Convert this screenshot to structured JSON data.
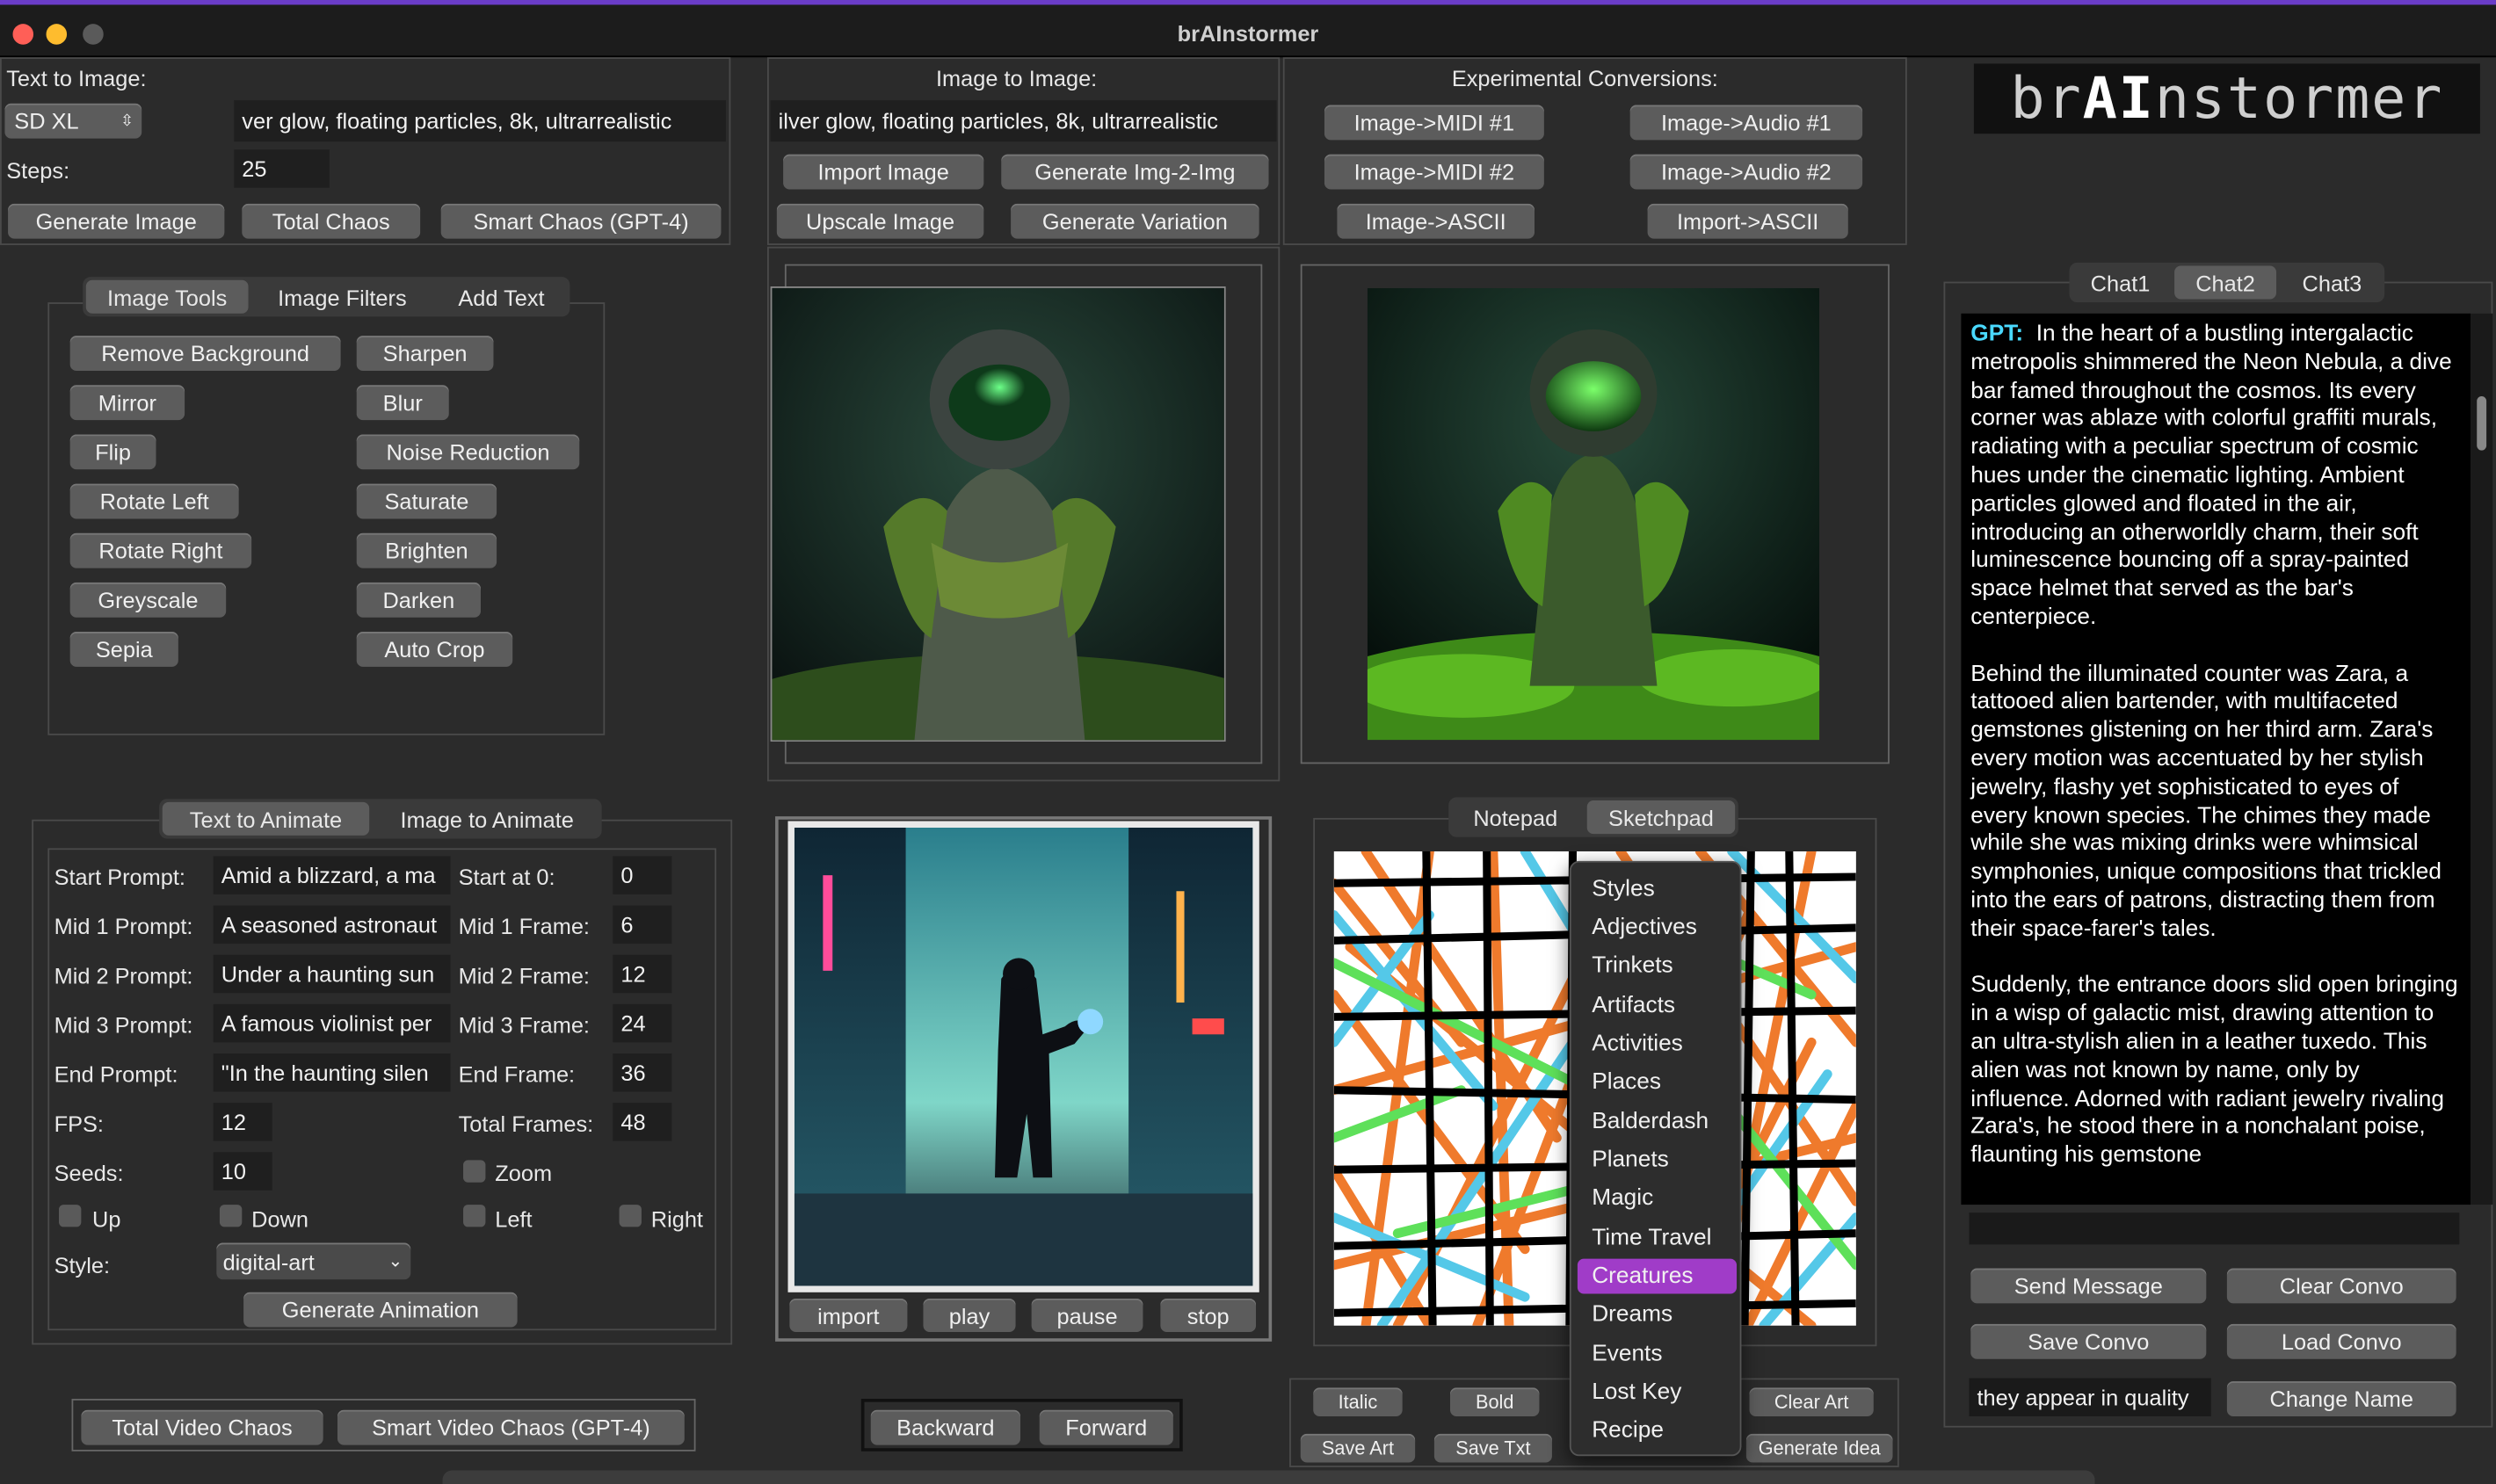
{
  "window": {
    "title": "brAInstormer"
  },
  "text_to_image": {
    "label": "Text to Image:",
    "model": "SD XL",
    "prompt": "ver glow, floating particles, 8k, ultrarrealistic",
    "steps_label": "Steps:",
    "steps": "25",
    "buttons": [
      "Generate Image",
      "Total Chaos",
      "Smart Chaos (GPT-4)"
    ]
  },
  "image_to_image": {
    "label": "Image to Image:",
    "prompt": "ilver glow, floating particles, 8k, ultrarrealistic",
    "buttons": [
      "Import Image",
      "Generate Img-2-Img",
      "Upscale Image",
      "Generate Variation"
    ]
  },
  "experimental": {
    "label": "Experimental Conversions:",
    "buttons": [
      "Image->MIDI #1",
      "Image->Audio #1",
      "Image->MIDI #2",
      "Image->Audio #2",
      "Image->ASCII",
      "Import->ASCII"
    ]
  },
  "logo": {
    "text_pre": "br",
    "text_ai": "AI",
    "text_post": "nstormer"
  },
  "image_tools": {
    "tabs": [
      "Image Tools",
      "Image Filters",
      "Add Text"
    ],
    "left": [
      "Remove Background",
      "Mirror",
      "Flip",
      "Rotate Left",
      "Rotate Right",
      "Greyscale",
      "Sepia"
    ],
    "right": [
      "Sharpen",
      "Blur",
      "Noise Reduction",
      "Saturate",
      "Brighten",
      "Darken",
      "Auto Crop"
    ]
  },
  "animate": {
    "tabs": [
      "Text to Animate",
      "Image to Animate"
    ],
    "prompts": [
      {
        "label": "Start Prompt:",
        "value": "Amid a blizzard, a ma",
        "frame_label": "Start at 0:",
        "frame": "0"
      },
      {
        "label": "Mid 1 Prompt:",
        "value": "A seasoned astronaut",
        "frame_label": "Mid 1 Frame:",
        "frame": "6"
      },
      {
        "label": "Mid 2 Prompt:",
        "value": "Under a haunting sun",
        "frame_label": "Mid 2 Frame:",
        "frame": "12"
      },
      {
        "label": "Mid 3 Prompt:",
        "value": "A famous violinist per",
        "frame_label": "Mid 3 Frame:",
        "frame": "24"
      },
      {
        "label": "End Prompt:",
        "value": "\"In the haunting silen",
        "frame_label": "End Frame:",
        "frame": "36"
      }
    ],
    "fps_label": "FPS:",
    "fps": "12",
    "total_frames_label": "Total Frames:",
    "total_frames": "48",
    "seeds_label": "Seeds:",
    "seeds": "10",
    "zoom": "Zoom",
    "up": "Up",
    "down": "Down",
    "left": "Left",
    "right": "Right",
    "style_label": "Style:",
    "style": "digital-art",
    "generate": "Generate Animation"
  },
  "video_controls": {
    "buttons": [
      "import",
      "play",
      "pause",
      "stop"
    ]
  },
  "bottom": {
    "chaos": [
      "Total Video Chaos",
      "Smart Video Chaos (GPT-4)"
    ],
    "nav": [
      "Backward",
      "Forward"
    ]
  },
  "sketch": {
    "tabs": [
      "Notepad",
      "Sketchpad"
    ],
    "buttons_row1": [
      "Italic",
      "Bold",
      "Clear Art"
    ],
    "buttons_row2": [
      "Save Art",
      "Save Txt",
      "Generate Idea"
    ]
  },
  "dropdown": {
    "items": [
      "Styles",
      "Adjectives",
      "Trinkets",
      "Artifacts",
      "Activities",
      "Places",
      "Balderdash",
      "Planets",
      "Magic",
      "Time Travel",
      "Creatures",
      "Dreams",
      "Events",
      "Lost Key",
      "Recipe"
    ],
    "highlighted": "Creatures"
  },
  "chat": {
    "tabs": [
      "Chat1",
      "Chat2",
      "Chat3"
    ],
    "speaker": "GPT:",
    "p1": "In the heart of a bustling intergalactic metropolis shimmered the Neon Nebula, a dive bar famed throughout the cosmos. Its every corner was ablaze with colorful graffiti murals, radiating with a peculiar spectrum of cosmic hues under the cinematic lighting. Ambient particles glowed and floated in the air, introducing an otherworldly charm, their soft luminescence bouncing off a spray-painted space helmet that served as the bar's centerpiece.",
    "p2": "Behind the illuminated counter was Zara, a tattooed alien bartender, with multifaceted gemstones glistening on her third arm. Zara's every motion was accentuated by her stylish jewelry, flashy yet sophisticated to eyes of every known species. The chimes they made while she was mixing drinks were whimsical symphonies, unique compositions that trickled into the ears of patrons, distracting them from their space-farer's tales.",
    "p3": "Suddenly, the entrance doors slid open bringing in a wisp of galactic mist, drawing attention to an ultra-stylish alien in a leather tuxedo. This alien was not known by name, only by influence. Adorned with radiant jewelry rivaling Zara's, he stood there in a nonchalant poise, flaunting his gemstone",
    "input": "",
    "buttons": [
      "Send Message",
      "Clear Convo",
      "Save Convo",
      "Load Convo",
      "Change Name"
    ],
    "name_field": "they appear in quality"
  },
  "colors": {
    "accent_purple": "#a03cc8",
    "speaker": "#4ad9ff"
  }
}
